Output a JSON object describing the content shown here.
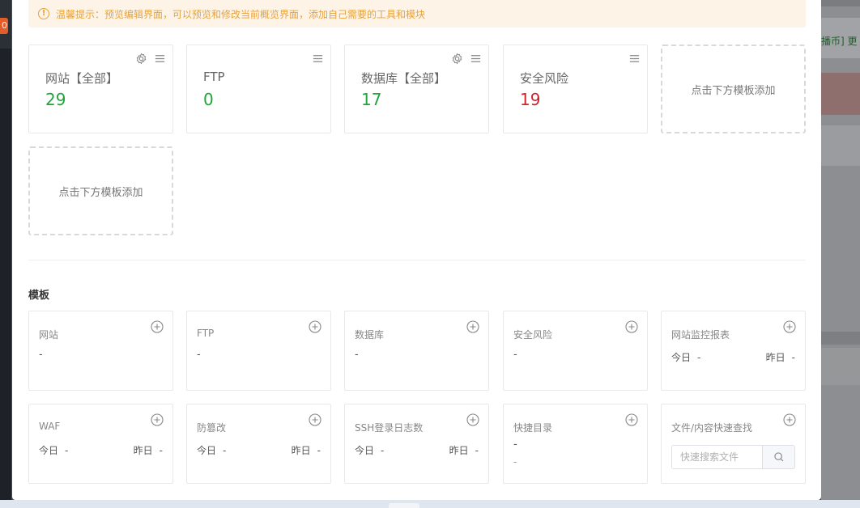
{
  "background": {
    "badge_text": "0",
    "right_link_text": "播币]  更"
  },
  "tip": {
    "icon": "exclamation-circle-icon",
    "text": "温馨提示：预览编辑界面，可以预览和修改当前概览界面，添加自己需要的工具和模块"
  },
  "stats": [
    {
      "title": "网站【全部】",
      "value": "29",
      "color": "#20a53a"
    },
    {
      "title": "FTP",
      "value": "0",
      "color": "#20a53a"
    },
    {
      "title": "数据库【全部】",
      "value": "17",
      "color": "#20a53a"
    },
    {
      "title": "安全风险",
      "value": "19",
      "color": "#d0232e"
    }
  ],
  "add_placeholder": "点击下方模板添加",
  "templates_title": "模板",
  "templates": [
    {
      "title": "网站",
      "value": "-"
    },
    {
      "title": "FTP",
      "value": "-"
    },
    {
      "title": "数据库",
      "value": "-"
    },
    {
      "title": "安全风险",
      "value": "-"
    },
    {
      "title": "网站监控报表",
      "today_label": "今日",
      "today_value": "-",
      "yesterday_label": "昨日",
      "yesterday_value": "-"
    },
    {
      "title": "WAF",
      "today_label": "今日",
      "today_value": "-",
      "yesterday_label": "昨日",
      "yesterday_value": "-"
    },
    {
      "title": "防篡改",
      "today_label": "今日",
      "today_value": "-",
      "yesterday_label": "昨日",
      "yesterday_value": "-"
    },
    {
      "title": "SSH登录日志数",
      "today_label": "今日",
      "today_value": "-",
      "yesterday_label": "昨日",
      "yesterday_value": "-"
    },
    {
      "title": "快捷目录",
      "value": "-",
      "value2": "-"
    },
    {
      "title": "文件/内容快速查找",
      "search_placeholder": "快速搜索文件"
    }
  ]
}
